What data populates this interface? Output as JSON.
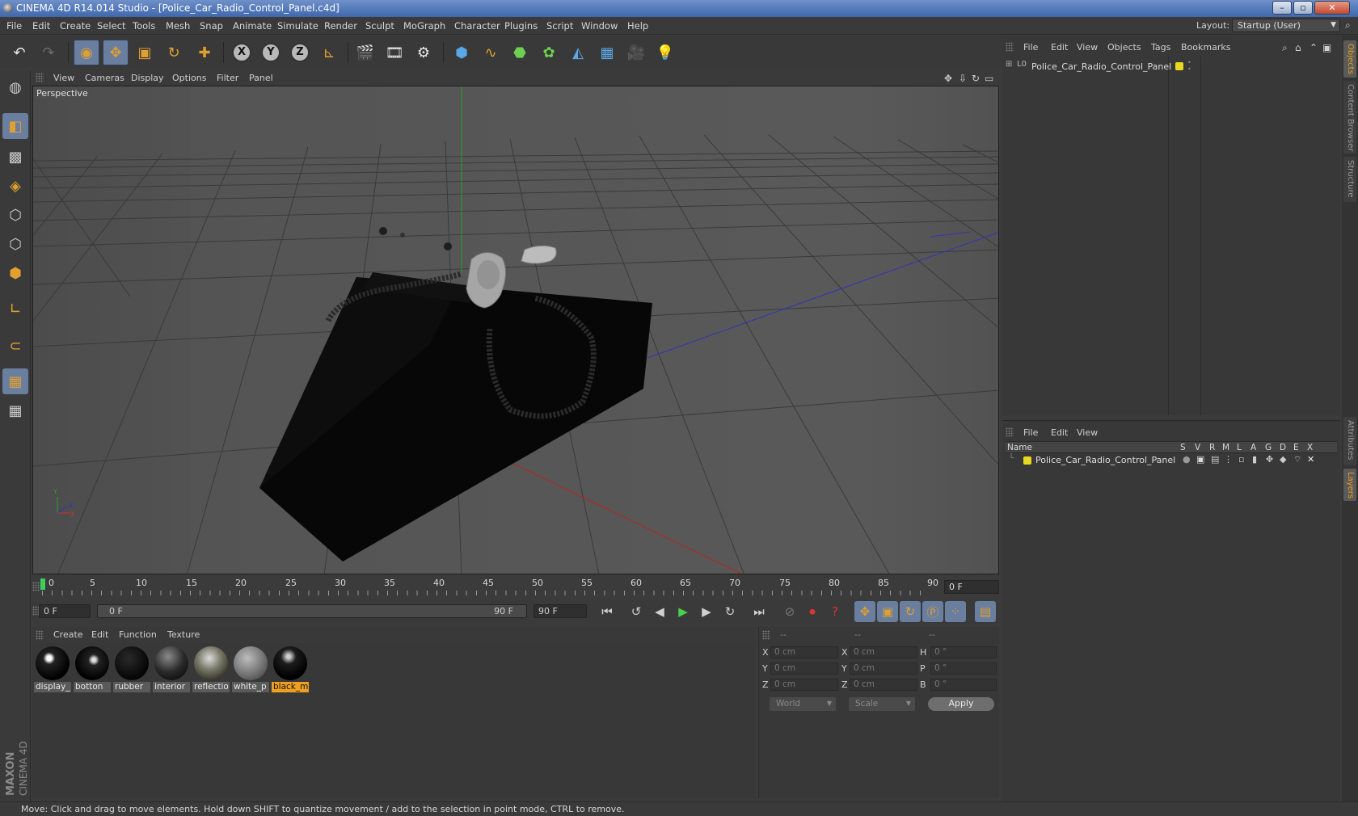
{
  "window": {
    "title": "CINEMA 4D R14.014 Studio - [Police_Car_Radio_Control_Panel.c4d]",
    "minimize": "–",
    "maximize": "▫",
    "close": "✕"
  },
  "menubar": {
    "items": [
      "File",
      "Edit",
      "Create",
      "Select",
      "Tools",
      "Mesh",
      "Snap",
      "Animate",
      "Simulate",
      "Render",
      "Sculpt",
      "MoGraph",
      "Character",
      "Plugins",
      "Script",
      "Window",
      "Help"
    ],
    "layout_label": "Layout:",
    "layout_value": "Startup (User)"
  },
  "viewport": {
    "menu": [
      "View",
      "Cameras",
      "Display",
      "Options",
      "Filter",
      "Panel"
    ],
    "label": "Perspective",
    "axis_y": "Y",
    "axis_z": "Z",
    "axis_x": "X"
  },
  "timeline": {
    "ticks": [
      "0",
      "5",
      "10",
      "15",
      "20",
      "25",
      "30",
      "35",
      "40",
      "45",
      "50",
      "55",
      "60",
      "65",
      "70",
      "75",
      "80",
      "85",
      "90"
    ],
    "current_frame": "0 F"
  },
  "transport": {
    "start_field": "0 F",
    "range_start": "0 F",
    "range_end": "90 F",
    "end_field": "90 F"
  },
  "materials": {
    "menu": [
      "Create",
      "Edit",
      "Function",
      "Texture"
    ],
    "items": [
      {
        "label": "display_",
        "style": "dark-texture"
      },
      {
        "label": "botton",
        "style": "dark-texture"
      },
      {
        "label": "rubber",
        "style": "black"
      },
      {
        "label": "interior",
        "style": "dark-gloss"
      },
      {
        "label": "reflectio",
        "style": "reflective"
      },
      {
        "label": "white_p",
        "style": "grey"
      },
      {
        "label": "black_m",
        "style": "black-gloss",
        "selected": true
      }
    ]
  },
  "coordinates": {
    "header": [
      "--",
      "--",
      "--"
    ],
    "rows": [
      {
        "a": "X",
        "av": "0 cm",
        "b": "X",
        "bv": "0 cm",
        "c": "H",
        "cv": "0 °"
      },
      {
        "a": "Y",
        "av": "0 cm",
        "b": "Y",
        "bv": "0 cm",
        "c": "P",
        "cv": "0 °"
      },
      {
        "a": "Z",
        "av": "0 cm",
        "b": "Z",
        "bv": "0 cm",
        "c": "B",
        "cv": "0 °"
      }
    ],
    "mode": "World",
    "scale": "Scale",
    "apply": "Apply"
  },
  "objects_panel": {
    "menu": [
      "File",
      "Edit",
      "View",
      "Objects",
      "Tags",
      "Bookmarks"
    ],
    "object_name": "Police_Car_Radio_Control_Panel"
  },
  "layers_panel": {
    "menu": [
      "File",
      "Edit",
      "View"
    ],
    "columns": [
      "Name",
      "S",
      "V",
      "R",
      "M",
      "L",
      "A",
      "G",
      "D",
      "E",
      "X"
    ],
    "layer_name": "Police_Car_Radio_Control_Panel"
  },
  "side_tabs": [
    "Objects",
    "Content Browser",
    "Structure",
    "Attributes",
    "Layers"
  ],
  "status": "Move: Click and drag to move elements. Hold down SHIFT to quantize movement / add to the selection in point mode, CTRL to remove.",
  "brand": {
    "line1": "MAXON",
    "line2": "CINEMA 4D"
  },
  "colors": {
    "accent": "#f0a020",
    "selected_tool": "#6a7ea0",
    "layer_color": "#e8d820"
  }
}
